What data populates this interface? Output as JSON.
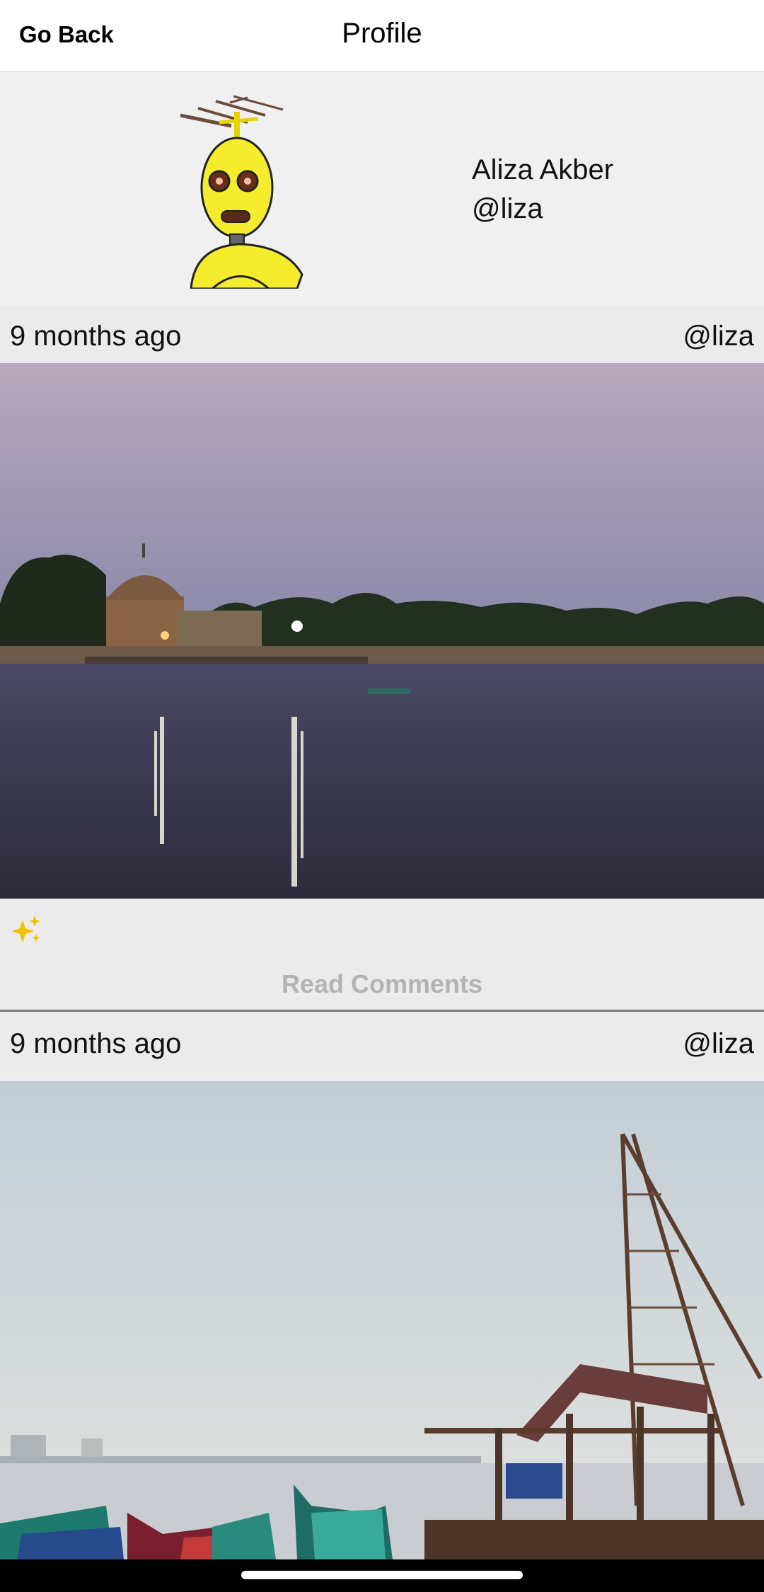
{
  "header": {
    "back_label": "Go Back",
    "title": "Profile"
  },
  "profile": {
    "name": "Aliza Akber",
    "handle": "@liza",
    "avatar_icon": "robot-avatar-icon"
  },
  "posts": [
    {
      "time": "9 months ago",
      "user": "@liza",
      "image_subject": "lake-temple-dusk",
      "reaction_icon": "sparkles-icon",
      "comments_label": "Read Comments"
    },
    {
      "time": "9 months ago",
      "user": "@liza",
      "image_subject": "fishing-harbor-boats"
    }
  ],
  "colors": {
    "header_bg": "#ffffff",
    "page_bg": "#eeeeee",
    "comments_text": "#b3b3b3",
    "sparkle": "#f2c200"
  }
}
